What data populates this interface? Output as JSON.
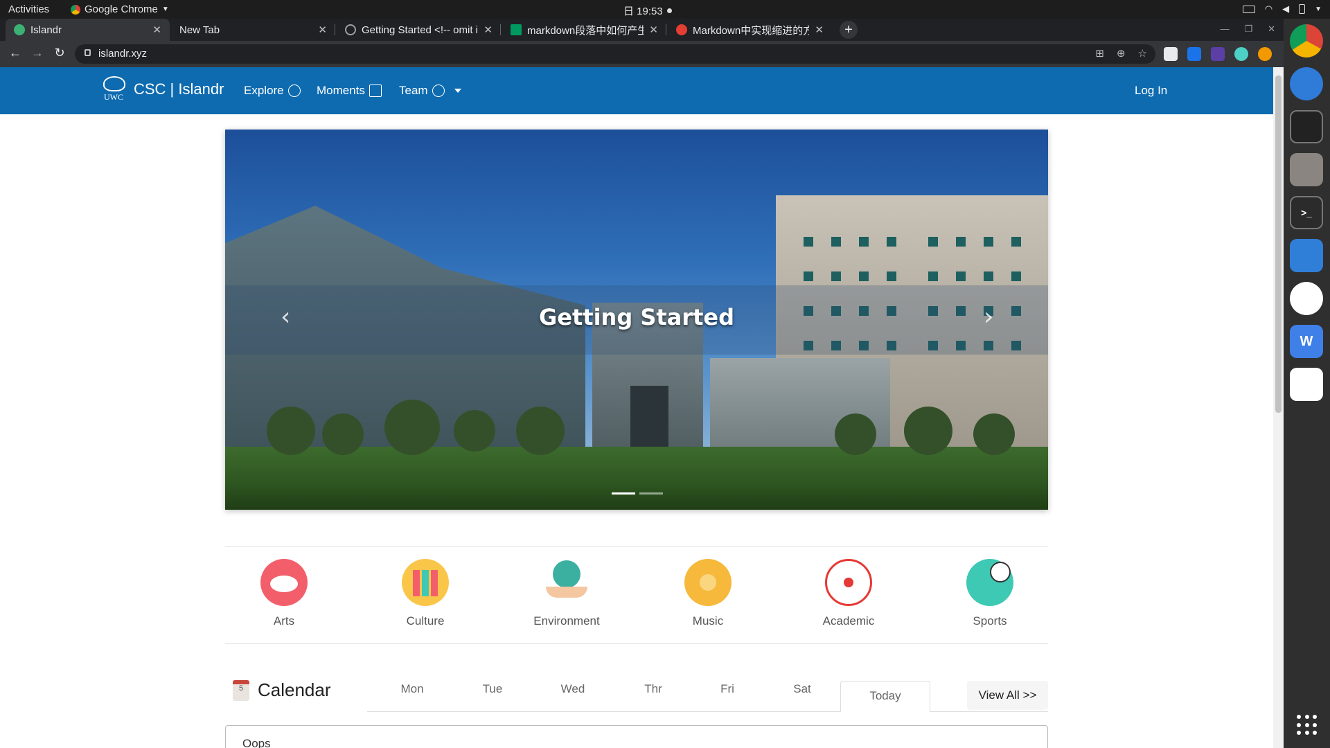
{
  "system": {
    "activities": "Activities",
    "app_name": "Google Chrome",
    "clock": "日 19:53"
  },
  "tabs": [
    {
      "title": "Islandr",
      "favicon": "islandr-globe",
      "color": "#3bb273"
    },
    {
      "title": "New Tab",
      "favicon": "none",
      "color": "#202124"
    },
    {
      "title": "Getting Started <!-- omit i",
      "favicon": "globe",
      "color": "#9aa0a6"
    },
    {
      "title": "markdown段落中如何产生",
      "favicon": "sf",
      "color": "#009a61"
    },
    {
      "title": "Markdown中实现缩进的方",
      "favicon": "csdn",
      "color": "#e33e33"
    }
  ],
  "address_bar": {
    "url": "islandr.xyz"
  },
  "site": {
    "brand_mark": "UWC",
    "brand": "CSC | Islandr",
    "nav": [
      {
        "label": "Explore",
        "icon": "compass-icon"
      },
      {
        "label": "Moments",
        "icon": "image-icon"
      },
      {
        "label": "Team",
        "icon": "people-icon"
      }
    ],
    "login": "Log In",
    "accent": "#0e6bb0"
  },
  "carousel": {
    "caption": "Getting Started",
    "prev": "‹",
    "next": "›",
    "slide_count": 2,
    "active_slide": 1
  },
  "categories": [
    {
      "label": "Arts",
      "icon": "palette-icon",
      "color": "#f25f6b"
    },
    {
      "label": "Culture",
      "icon": "books-icon",
      "color": "#f9c64a"
    },
    {
      "label": "Environment",
      "icon": "globe-hands-icon",
      "color": "#3bb0a0"
    },
    {
      "label": "Music",
      "icon": "vinyl-icon",
      "color": "#f6b93b"
    },
    {
      "label": "Academic",
      "icon": "atom-icon",
      "color": "#e53935"
    },
    {
      "label": "Sports",
      "icon": "soccer-icon",
      "color": "#3ec9b5"
    }
  ],
  "calendar": {
    "heading": "Calendar",
    "icon_day": "5",
    "days": [
      "Mon",
      "Tue",
      "Wed",
      "Thr",
      "Fri",
      "Sat",
      "Today"
    ],
    "view_all": "View All >>",
    "empty_message": "Oops"
  }
}
